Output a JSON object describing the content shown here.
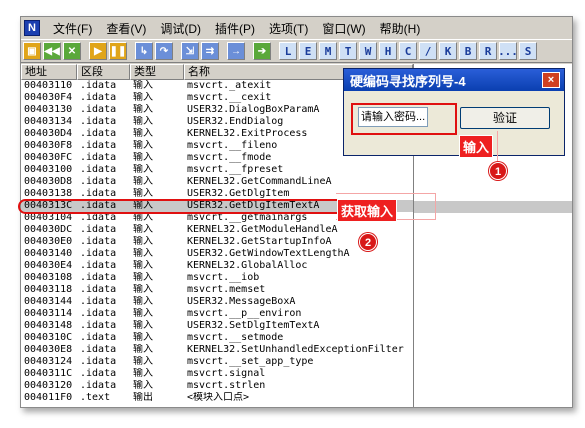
{
  "menubar": {
    "app_icon": "N",
    "items": [
      "文件(F)",
      "查看(V)",
      "调试(D)",
      "插件(P)",
      "选项(T)",
      "窗口(W)",
      "帮助(H)"
    ]
  },
  "toolbar": {
    "letters": [
      "L",
      "E",
      "M",
      "T",
      "W",
      "H",
      "C",
      "/",
      "K",
      "B",
      "R",
      "...",
      "S"
    ]
  },
  "table": {
    "headers": [
      "地址",
      "区段",
      "类型",
      "名称"
    ],
    "rows": [
      [
        "00403110",
        ".idata",
        "输入",
        "msvcrt._atexit"
      ],
      [
        "004030F4",
        ".idata",
        "输入",
        "msvcrt.__cexit"
      ],
      [
        "00403130",
        ".idata",
        "输入",
        "USER32.DialogBoxParamA"
      ],
      [
        "00403134",
        ".idata",
        "输入",
        "USER32.EndDialog"
      ],
      [
        "004030D4",
        ".idata",
        "输入",
        "KERNEL32.ExitProcess"
      ],
      [
        "004030F8",
        ".idata",
        "输入",
        "msvcrt.__fileno"
      ],
      [
        "004030FC",
        ".idata",
        "输入",
        "msvcrt.__fmode"
      ],
      [
        "00403100",
        ".idata",
        "输入",
        "msvcrt.__fpreset"
      ],
      [
        "004030D8",
        ".idata",
        "输入",
        "KERNEL32.GetCommandLineA"
      ],
      [
        "00403138",
        ".idata",
        "输入",
        "USER32.GetDlgItem"
      ],
      [
        "0040313C",
        ".idata",
        "输入",
        "USER32.GetDlgItemTextA"
      ],
      [
        "00403104",
        ".idata",
        "输入",
        "msvcrt.__getmainargs"
      ],
      [
        "004030DC",
        ".idata",
        "输入",
        "KERNEL32.GetModuleHandleA"
      ],
      [
        "004030E0",
        ".idata",
        "输入",
        "KERNEL32.GetStartupInfoA"
      ],
      [
        "00403140",
        ".idata",
        "输入",
        "USER32.GetWindowTextLengthA"
      ],
      [
        "004030E4",
        ".idata",
        "输入",
        "KERNEL32.GlobalAlloc"
      ],
      [
        "00403108",
        ".idata",
        "输入",
        "msvcrt.__iob"
      ],
      [
        "00403118",
        ".idata",
        "输入",
        "msvcrt.memset"
      ],
      [
        "00403144",
        ".idata",
        "输入",
        "USER32.MessageBoxA"
      ],
      [
        "00403114",
        ".idata",
        "输入",
        "msvcrt.__p__environ"
      ],
      [
        "00403148",
        ".idata",
        "输入",
        "USER32.SetDlgItemTextA"
      ],
      [
        "0040310C",
        ".idata",
        "输入",
        "msvcrt.__setmode"
      ],
      [
        "004030E8",
        ".idata",
        "输入",
        "KERNEL32.SetUnhandledExceptionFilter"
      ],
      [
        "00403124",
        ".idata",
        "输入",
        "msvcrt.__set_app_type"
      ],
      [
        "0040311C",
        ".idata",
        "输入",
        "msvcrt.signal"
      ],
      [
        "00403120",
        ".idata",
        "输入",
        "msvcrt.strlen"
      ],
      [
        "004011F0",
        ".text",
        "输出",
        "<模块入口点>"
      ]
    ]
  },
  "dialog": {
    "title": "硬编码寻找序列号-4",
    "close": "×",
    "input_value": "请输入密码...",
    "verify_label": "验证"
  },
  "annotations": {
    "label_input": "输入",
    "label_get_input": "获取输入",
    "step1": "1",
    "step2": "2"
  },
  "colors": {
    "annotation": "#e01010",
    "title_bar": "#0a3fb0",
    "highlight_row": "#c8c8c8"
  }
}
